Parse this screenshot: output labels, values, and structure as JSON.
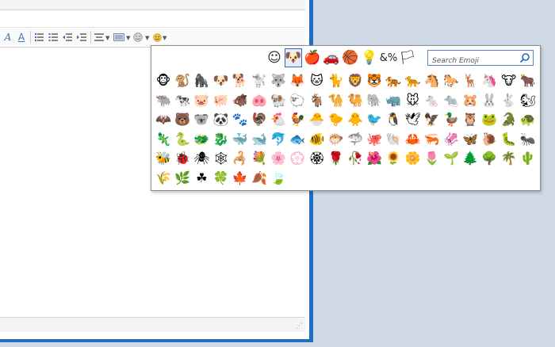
{
  "toolbar": {
    "icons": [
      "font-color-icon",
      "text-color-icon",
      "bulleted-list-icon",
      "numbered-list-icon",
      "decrease-indent-icon",
      "increase-indent-icon",
      "align-icon",
      "background-icon",
      "emoji-icon",
      "emoji-small-icon"
    ]
  },
  "picker": {
    "categories": [
      {
        "name": "smileys",
        "glyph": "☺"
      },
      {
        "name": "animals",
        "glyph": "🐶"
      },
      {
        "name": "food",
        "glyph": "🍎"
      },
      {
        "name": "travel",
        "glyph": "🚗"
      },
      {
        "name": "activities",
        "glyph": "🏀"
      },
      {
        "name": "objects",
        "glyph": "💡"
      },
      {
        "name": "symbols",
        "glyph": "&%"
      },
      {
        "name": "flags",
        "glyph": "🏳"
      }
    ],
    "active_category": "animals",
    "search_placeholder": "Search Emoji",
    "emoji_rows": [
      [
        "🐵",
        "🐒",
        "🦍",
        "🐶",
        "🐕",
        "🐩",
        "🐺",
        "🦊",
        "🐱",
        "🐈",
        "🦁",
        "🐯",
        "🐅",
        "🐆",
        "🐴",
        "🐎",
        "🦌",
        "🦄",
        "🐮",
        "🐂"
      ],
      [
        "🐃",
        "🐄",
        "🐷",
        "🐖",
        "🐗",
        "🐽",
        "🐏",
        "🐑",
        "🐐",
        "🐪",
        "🐫",
        "🐘",
        "🦏",
        "🐭",
        "🐁",
        "🐀",
        "🐹",
        "🐰",
        "🐇",
        "🐿"
      ],
      [
        "🦇",
        "🐻",
        "🐨",
        "🐼",
        "🐾",
        "🦃",
        "🐔",
        "🐓",
        "🐣",
        "🐤",
        "🐥",
        "🐦",
        "🐧",
        "🕊",
        "🦅",
        "🦆",
        "🦉",
        "🐸",
        "🐊",
        "🐢"
      ],
      [
        "🦎",
        "🐍",
        "🐲",
        "🐉",
        "🐳",
        "🐋",
        "🐬",
        "🐟",
        "🐠",
        "🐡",
        "🦈",
        "🐙",
        "🐚",
        "🦀",
        "🦐",
        "🦑",
        "🦋",
        "🐌",
        "🐛",
        "🐜"
      ],
      [
        "🐝",
        "🐞",
        "🕷",
        "🕸",
        "🦂",
        "💐",
        "🌸",
        "💮",
        "🏵",
        "🌹",
        "🥀",
        "🌺",
        "🌻",
        "🌼",
        "🌷",
        "🌱",
        "🌲",
        "🌳",
        "🌴",
        "🌵"
      ],
      [
        "🌾",
        "🌿",
        "☘",
        "🍀",
        "🍁",
        "🍂",
        "🍃"
      ]
    ]
  }
}
